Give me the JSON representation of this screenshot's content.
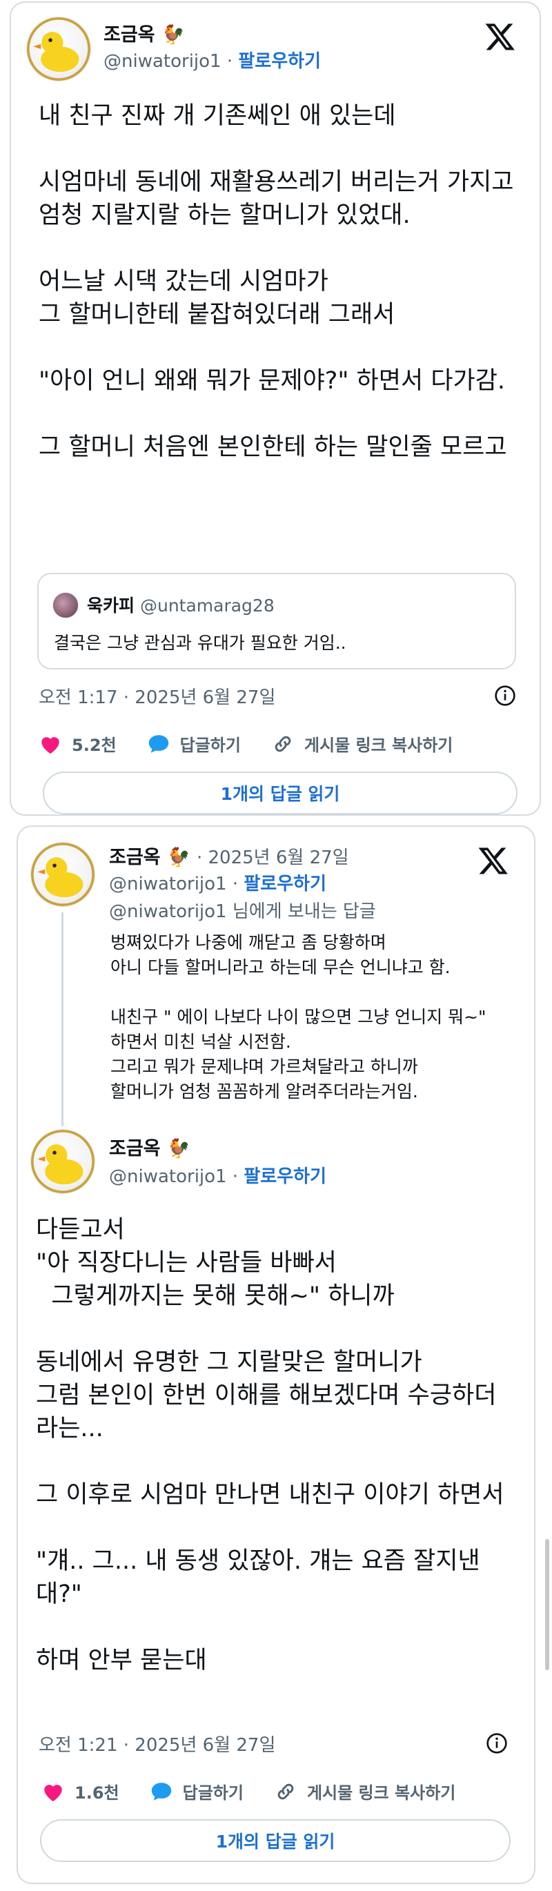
{
  "tweet1": {
    "name": "조금옥",
    "name_emoji": "🐓",
    "handle": "@niwatorijo1",
    "separator": "·",
    "follow": "팔로우하기",
    "body": "내 친구 진짜 개 기존쎄인 애 있는데\n\n시엄마네 동네에 재활용쓰레기 버리는거 가지고\n엄청 지랄지랄 하는 할머니가 있었대.\n\n어느날 시댁 갔는데 시엄마가\n그 할머니한테 붙잡혀있더래 그래서\n\n\"아이 언니 왜왜 뭐가 문제야?\" 하면서 다가감.\n\n그 할머니 처음엔 본인한테 하는 말인줄 모르고",
    "quote": {
      "name": "욱카피",
      "handle": "@untamarag28",
      "text": "결국은 그냥 관심과 유대가 필요한 거임.."
    },
    "timestamp": "오전 1:17 · 2025년 6월 27일",
    "likes": "5.2천",
    "reply_label": "답글하기",
    "share_label": "게시물 링크 복사하기",
    "read_replies": "1개의 답글 읽기"
  },
  "tweet2": {
    "name": "조금옥",
    "name_emoji": "🐓",
    "date": "· 2025년 6월 27일",
    "handle": "@niwatorijo1",
    "separator": "·",
    "follow": "팔로우하기",
    "reply_to_handle": "@niwatorijo1",
    "reply_to_suffix": "님에게 보내는 답글",
    "reply_body": "벙쪄있다가 나중에 깨닫고 좀 당황하며\n아니 다들 할머니라고 하는데 무슨 언니냐고 함.\n\n내친구 \" 에이 나보다 나이 많으면 그냥 언니지 뭐~\"\n하면서 미친 넉살 시전함.\n그리고 뭐가 문제냐며 가르쳐달라고 하니까\n할머니가 엄청 꼼꼼하게 알려주더라는거임.",
    "second_name": "조금옥",
    "second_handle": "@niwatorijo1",
    "body": "다듣고서\n\"아 직장다니는 사람들 바빠서\n  그렇게까지는 못해 못해~\" 하니까\n\n동네에서 유명한 그 지랄맞은 할머니가\n그럼 본인이 한번 이해를 해보겠다며 수긍하더라는...\n\n그 이후로 시엄마 만나면 내친구 이야기 하면서\n\n\"걔.. 그... 내 동생 있잖아. 걔는 요즘 잘지낸대?\"\n\n하며 안부 묻는대",
    "timestamp": "오전 1:21 · 2025년 6월 27일",
    "likes": "1.6천",
    "reply_label": "답글하기",
    "share_label": "게시물 링크 복사하기",
    "read_replies": "1개의 답글 읽기"
  },
  "colors": {
    "accent": "#1d6fd1",
    "heart": "#f91880",
    "reply_bubble": "#1d9bf0",
    "muted": "#536471",
    "border": "#d6dbdf"
  },
  "icons": [
    "x-logo-icon",
    "heart-icon",
    "reply-icon",
    "link-icon",
    "info-icon",
    "duck-avatar-icon"
  ]
}
